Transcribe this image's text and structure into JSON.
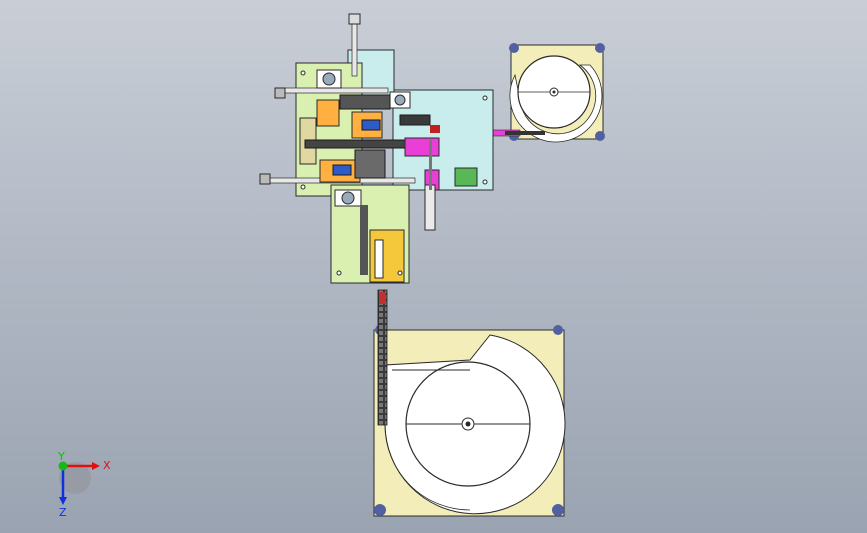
{
  "viewport": {
    "background_top": "#c9ced6",
    "background_bottom": "#9aa3b1"
  },
  "colors": {
    "plate_cream": "#f3eeb9",
    "plate_green": "#d9f0b0",
    "plate_cyan": "#c9ecec",
    "magenta": "#e93fd7",
    "outline": "#2a2a2a",
    "axis_x": "#e01010",
    "axis_y": "#18b818",
    "axis_z": "#1030e0"
  },
  "triad": {
    "x_label": "X",
    "y_label": "Y",
    "z_label": "Z"
  }
}
